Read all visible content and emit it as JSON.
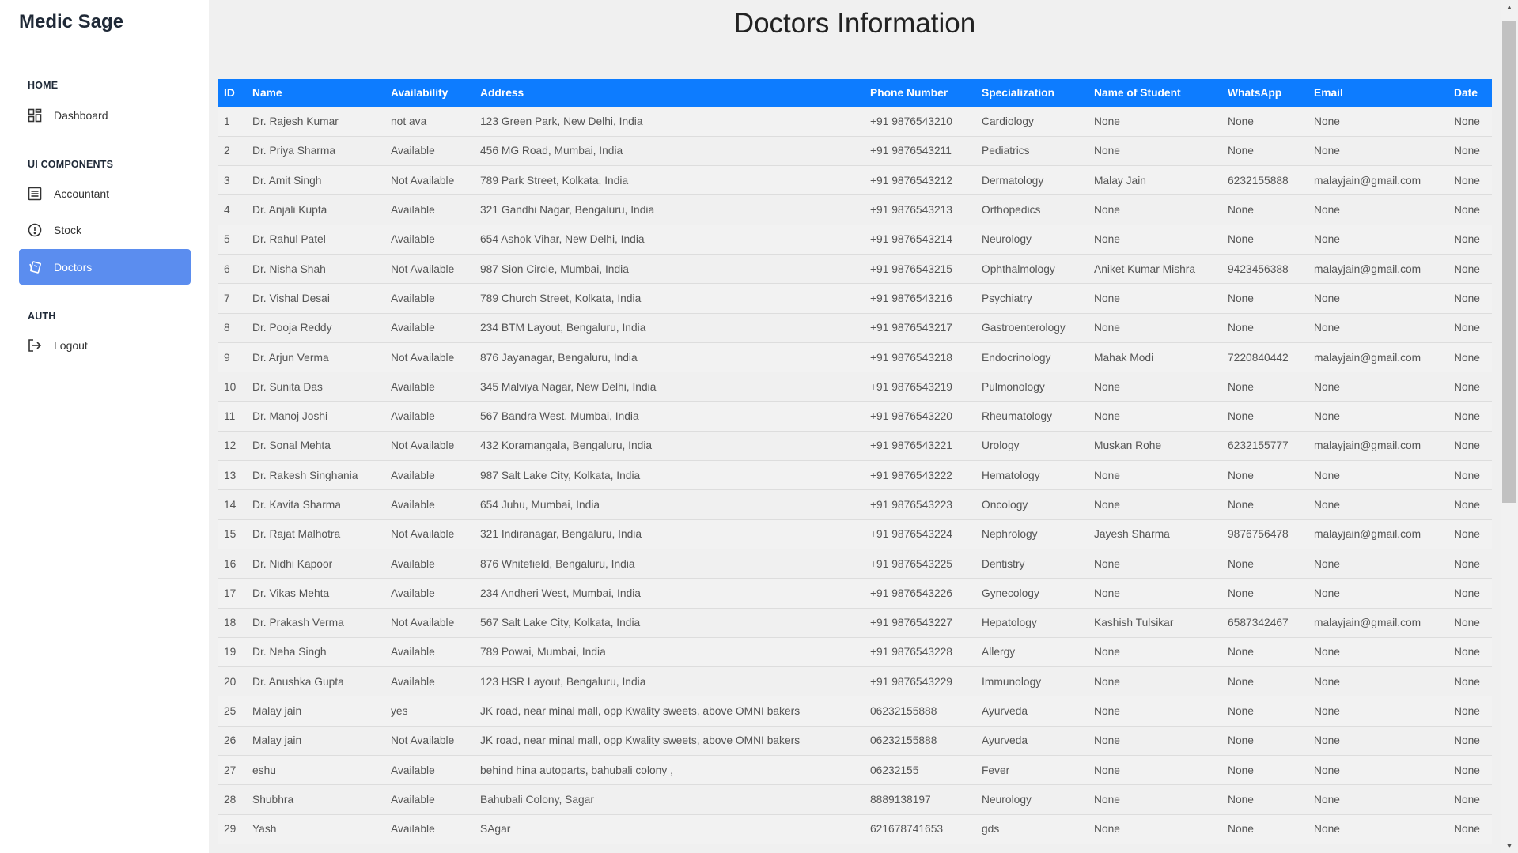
{
  "sidebar": {
    "brand": "Medic Sage",
    "sections": {
      "home": "HOME",
      "ui_components": "UI COMPONENTS",
      "auth": "AUTH"
    },
    "items": {
      "dashboard": {
        "label": "Dashboard",
        "icon": "dashboard-icon"
      },
      "accountant": {
        "label": "Accountant",
        "icon": "list-icon"
      },
      "stock": {
        "label": "Stock",
        "icon": "alert-circle-icon"
      },
      "doctors": {
        "label": "Doctors",
        "icon": "cards-icon",
        "active": true
      },
      "logout": {
        "label": "Logout",
        "icon": "logout-icon"
      }
    },
    "active_color": "#5b8def"
  },
  "main": {
    "title": "Doctors Information",
    "header_color": "#0d7cff",
    "columns": [
      "ID",
      "Name",
      "Availability",
      "Address",
      "Phone Number",
      "Specialization",
      "Name of Student",
      "WhatsApp",
      "Email",
      "Date"
    ],
    "rows": [
      [
        "1",
        "Dr. Rajesh Kumar",
        "not ava",
        "123 Green Park, New Delhi, India",
        "+91 9876543210",
        "Cardiology",
        "None",
        "None",
        "None",
        "None"
      ],
      [
        "2",
        "Dr. Priya Sharma",
        "Available",
        "456 MG Road, Mumbai, India",
        "+91 9876543211",
        "Pediatrics",
        "None",
        "None",
        "None",
        "None"
      ],
      [
        "3",
        "Dr. Amit Singh",
        "Not Available",
        "789 Park Street, Kolkata, India",
        "+91 9876543212",
        "Dermatology",
        "Malay Jain",
        "6232155888",
        "malayjain@gmail.com",
        "None"
      ],
      [
        "4",
        "Dr. Anjali Kupta",
        "Available",
        "321 Gandhi Nagar, Bengaluru, India",
        "+91 9876543213",
        "Orthopedics",
        "None",
        "None",
        "None",
        "None"
      ],
      [
        "5",
        "Dr. Rahul Patel",
        "Available",
        "654 Ashok Vihar, New Delhi, India",
        "+91 9876543214",
        "Neurology",
        "None",
        "None",
        "None",
        "None"
      ],
      [
        "6",
        "Dr. Nisha Shah",
        "Not Available",
        "987 Sion Circle, Mumbai, India",
        "+91 9876543215",
        "Ophthalmology",
        "Aniket Kumar Mishra",
        "9423456388",
        "malayjain@gmail.com",
        "None"
      ],
      [
        "7",
        "Dr. Vishal Desai",
        "Available",
        "789 Church Street, Kolkata, India",
        "+91 9876543216",
        "Psychiatry",
        "None",
        "None",
        "None",
        "None"
      ],
      [
        "8",
        "Dr. Pooja Reddy",
        "Available",
        "234 BTM Layout, Bengaluru, India",
        "+91 9876543217",
        "Gastroenterology",
        "None",
        "None",
        "None",
        "None"
      ],
      [
        "9",
        "Dr. Arjun Verma",
        "Not Available",
        "876 Jayanagar, Bengaluru, India",
        "+91 9876543218",
        "Endocrinology",
        "Mahak Modi",
        "7220840442",
        "malayjain@gmail.com",
        "None"
      ],
      [
        "10",
        "Dr. Sunita Das",
        "Available",
        "345 Malviya Nagar, New Delhi, India",
        "+91 9876543219",
        "Pulmonology",
        "None",
        "None",
        "None",
        "None"
      ],
      [
        "11",
        "Dr. Manoj Joshi",
        "Available",
        "567 Bandra West, Mumbai, India",
        "+91 9876543220",
        "Rheumatology",
        "None",
        "None",
        "None",
        "None"
      ],
      [
        "12",
        "Dr. Sonal Mehta",
        "Not Available",
        "432 Koramangala, Bengaluru, India",
        "+91 9876543221",
        "Urology",
        "Muskan Rohe",
        "6232155777",
        "malayjain@gmail.com",
        "None"
      ],
      [
        "13",
        "Dr. Rakesh Singhania",
        "Available",
        "987 Salt Lake City, Kolkata, India",
        "+91 9876543222",
        "Hematology",
        "None",
        "None",
        "None",
        "None"
      ],
      [
        "14",
        "Dr. Kavita Sharma",
        "Available",
        "654 Juhu, Mumbai, India",
        "+91 9876543223",
        "Oncology",
        "None",
        "None",
        "None",
        "None"
      ],
      [
        "15",
        "Dr. Rajat Malhotra",
        "Not Available",
        "321 Indiranagar, Bengaluru, India",
        "+91 9876543224",
        "Nephrology",
        "Jayesh Sharma",
        "9876756478",
        "malayjain@gmail.com",
        "None"
      ],
      [
        "16",
        "Dr. Nidhi Kapoor",
        "Available",
        "876 Whitefield, Bengaluru, India",
        "+91 9876543225",
        "Dentistry",
        "None",
        "None",
        "None",
        "None"
      ],
      [
        "17",
        "Dr. Vikas Mehta",
        "Available",
        "234 Andheri West, Mumbai, India",
        "+91 9876543226",
        "Gynecology",
        "None",
        "None",
        "None",
        "None"
      ],
      [
        "18",
        "Dr. Prakash Verma",
        "Not Available",
        "567 Salt Lake City, Kolkata, India",
        "+91 9876543227",
        "Hepatology",
        "Kashish Tulsikar",
        "6587342467",
        "malayjain@gmail.com",
        "None"
      ],
      [
        "19",
        "Dr. Neha Singh",
        "Available",
        "789 Powai, Mumbai, India",
        "+91 9876543228",
        "Allergy",
        "None",
        "None",
        "None",
        "None"
      ],
      [
        "20",
        "Dr. Anushka Gupta",
        "Available",
        "123 HSR Layout, Bengaluru, India",
        "+91 9876543229",
        "Immunology",
        "None",
        "None",
        "None",
        "None"
      ],
      [
        "25",
        "Malay jain",
        "yes",
        "JK road, near minal mall, opp Kwality sweets, above OMNI bakers",
        "06232155888",
        "Ayurveda",
        "None",
        "None",
        "None",
        "None"
      ],
      [
        "26",
        "Malay jain",
        "Not Available",
        "JK road, near minal mall, opp Kwality sweets, above OMNI bakers",
        "06232155888",
        "Ayurveda",
        "None",
        "None",
        "None",
        "None"
      ],
      [
        "27",
        "eshu",
        "Available",
        "behind hina autoparts, bahubali colony ,",
        "06232155",
        "Fever",
        "None",
        "None",
        "None",
        "None"
      ],
      [
        "28",
        "Shubhra",
        "Available",
        "Bahubali Colony, Sagar",
        "8889138197",
        "Neurology",
        "None",
        "None",
        "None",
        "None"
      ],
      [
        "29",
        "Yash",
        "Available",
        "SAgar",
        "621678741653",
        "gds",
        "None",
        "None",
        "None",
        "None"
      ]
    ]
  },
  "scrollbar": {
    "up_icon": "scroll-up-arrow-icon",
    "down_icon": "scroll-down-arrow-icon"
  }
}
